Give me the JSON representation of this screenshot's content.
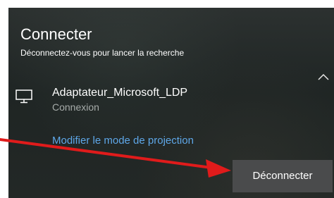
{
  "panel": {
    "title": "Connecter",
    "subtitle": "Déconnectez-vous pour lancer la recherche",
    "collapse_icon": "chevron-up-icon"
  },
  "device": {
    "icon": "monitor-icon",
    "name": "Adaptateur_Microsoft_LDP",
    "status": "Connexion"
  },
  "actions": {
    "modify_projection_label": "Modifier le mode de projection",
    "disconnect_label": "Déconnecter"
  },
  "annotation": {
    "icon": "red-arrow-annotation",
    "color": "#e01b1b"
  },
  "colors": {
    "link": "#5ea7e8",
    "button_bg": "#4a4b4c",
    "status_text": "#a7acaa"
  }
}
